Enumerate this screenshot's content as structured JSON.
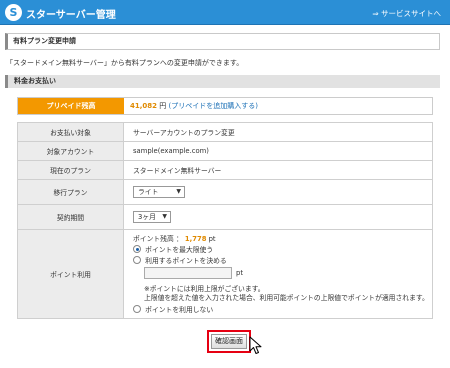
{
  "header": {
    "logo_letter": "S",
    "title": "スターサーバー管理",
    "site_link": "⇒ サービスサイトへ"
  },
  "page": {
    "section_title": "有料プラン変更申請",
    "description": "「スタードメイン無料サーバー」から有料プランへの変更申請ができます。",
    "subheader": "料金お支払い"
  },
  "prepaid": {
    "label": "プリペイド残高",
    "amount": "41,082",
    "unit": "円",
    "link": "(プリペイドを追加購入する)"
  },
  "details": {
    "payment_target_label": "お支払い対象",
    "payment_target_value": "サーバーアカウントのプラン変更",
    "account_label": "対象アカウント",
    "account_value": "sample(example.com)",
    "current_plan_label": "現在のプラン",
    "current_plan_value": "スタードメイン無料サーバー",
    "migration_plan_label": "移行プラン",
    "migration_plan_value": "ライト",
    "contract_period_label": "契約期間",
    "contract_period_value": "3ヶ月"
  },
  "points": {
    "label": "ポイント利用",
    "balance_label": "ポイント残高 ：",
    "balance_value": "1,778",
    "balance_unit": "pt",
    "option_max": "ポイントを最大限使う",
    "option_specify": "利用するポイントを決める",
    "input_value": "",
    "input_unit": "pt",
    "note1": "※ポイントには利用上限がございます。",
    "note2": "上限値を超えた値を入力された場合、利用可能ポイントの上限値でポイントが適用されます。",
    "option_none": "ポイントを利用しない"
  },
  "confirm_button": "確認画面"
}
